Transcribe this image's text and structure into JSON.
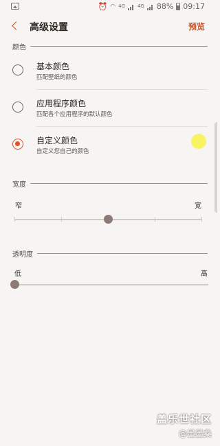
{
  "status_bar": {
    "battery": "88%",
    "time": "09:17",
    "net1": "4G",
    "net2": "4G"
  },
  "header": {
    "title": "高级设置",
    "preview": "预览"
  },
  "color_section": {
    "label": "颜色",
    "options": [
      {
        "title": "基本颜色",
        "subtitle": "匹配壁纸的颜色",
        "selected": false
      },
      {
        "title": "应用程序颜色",
        "subtitle": "匹配各个应用程序的默认颜色",
        "selected": false
      },
      {
        "title": "自定义颜色",
        "subtitle": "自定义您自己的颜色",
        "selected": true
      }
    ]
  },
  "width_section": {
    "label": "宽度",
    "min_label": "窄",
    "max_label": "宽",
    "value_fraction": 0.5,
    "steps": 4
  },
  "opacity_section": {
    "label": "透明度",
    "min_label": "低",
    "max_label": "高",
    "value_fraction": 0.0
  },
  "watermark": {
    "brand": "盖乐世社区",
    "user": "@墨墨桑"
  },
  "colors": {
    "accent": "#d9532c",
    "thumb": "#8c7a76",
    "touch": "#f7f25a"
  }
}
